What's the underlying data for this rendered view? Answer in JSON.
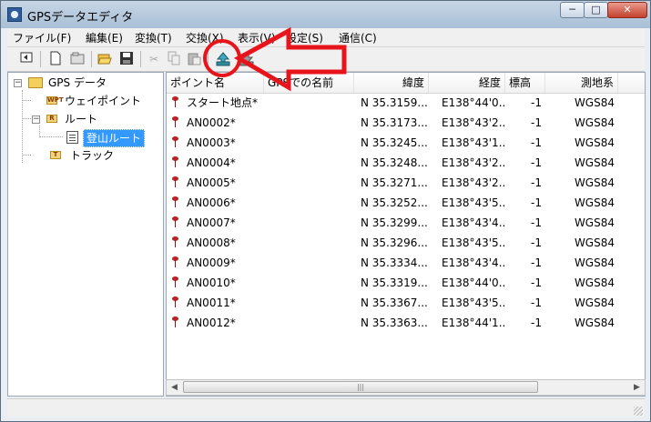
{
  "window": {
    "title": "GPSデータエディタ",
    "buttons": {
      "minimize": "─",
      "maximize": "□",
      "close": "✕"
    }
  },
  "menu": [
    {
      "label": "ファイル(F)"
    },
    {
      "label": "編集(E)"
    },
    {
      "label": "変換(T)"
    },
    {
      "label": "交換(X)"
    },
    {
      "label": "表示(V)"
    },
    {
      "label": "設定(S)"
    },
    {
      "label": "通信(C)"
    }
  ],
  "toolbar": {
    "icons": [
      "back-icon",
      "new-file-icon",
      "new-folder-icon",
      "open-folder-icon",
      "save-icon",
      "cut-icon",
      "copy-icon",
      "paste-icon",
      "upload-icon",
      "download-icon"
    ]
  },
  "tree": {
    "root": "GPS データ",
    "waypoints": "ウェイポイント",
    "waypoints_badge": "WPT",
    "route": "ルート",
    "route_badge": "R",
    "route_child": "登山ルート",
    "track": "トラック",
    "track_badge": "T"
  },
  "table": {
    "columns": [
      "ポイント名",
      "GPSでの名前",
      "緯度",
      "経度",
      "標高",
      "測地系"
    ],
    "rows": [
      {
        "name": "スタート地点*",
        "gps_name": "",
        "lat": "N 35.3159...",
        "lon": "E138°44'0...",
        "alt": "-1",
        "datum": "WGS84"
      },
      {
        "name": "AN0002*",
        "gps_name": "",
        "lat": "N 35.3173...",
        "lon": "E138°43'2...",
        "alt": "-1",
        "datum": "WGS84"
      },
      {
        "name": "AN0003*",
        "gps_name": "",
        "lat": "N 35.3245...",
        "lon": "E138°43'1...",
        "alt": "-1",
        "datum": "WGS84"
      },
      {
        "name": "AN0004*",
        "gps_name": "",
        "lat": "N 35.3248...",
        "lon": "E138°43'2...",
        "alt": "-1",
        "datum": "WGS84"
      },
      {
        "name": "AN0005*",
        "gps_name": "",
        "lat": "N 35.3271...",
        "lon": "E138°43'2...",
        "alt": "-1",
        "datum": "WGS84"
      },
      {
        "name": "AN0006*",
        "gps_name": "",
        "lat": "N 35.3252...",
        "lon": "E138°43'5...",
        "alt": "-1",
        "datum": "WGS84"
      },
      {
        "name": "AN0007*",
        "gps_name": "",
        "lat": "N 35.3299...",
        "lon": "E138°43'4...",
        "alt": "-1",
        "datum": "WGS84"
      },
      {
        "name": "AN0008*",
        "gps_name": "",
        "lat": "N 35.3296...",
        "lon": "E138°43'5...",
        "alt": "-1",
        "datum": "WGS84"
      },
      {
        "name": "AN0009*",
        "gps_name": "",
        "lat": "N 35.3334...",
        "lon": "E138°43'4...",
        "alt": "-1",
        "datum": "WGS84"
      },
      {
        "name": "AN0010*",
        "gps_name": "",
        "lat": "N 35.3319...",
        "lon": "E138°44'0...",
        "alt": "-1",
        "datum": "WGS84"
      },
      {
        "name": "AN0011*",
        "gps_name": "",
        "lat": "N 35.3367...",
        "lon": "E138°43'5...",
        "alt": "-1",
        "datum": "WGS84"
      },
      {
        "name": "AN0012*",
        "gps_name": "",
        "lat": "N 35.3363...",
        "lon": "E138°44'1...",
        "alt": "-1",
        "datum": "WGS84"
      }
    ]
  },
  "scrollbar": {
    "left": "◀",
    "right": "▶",
    "grip": "|||"
  },
  "colors": {
    "annotation": "#e8141c",
    "selection": "#3399ff",
    "pin": "#b22222"
  }
}
